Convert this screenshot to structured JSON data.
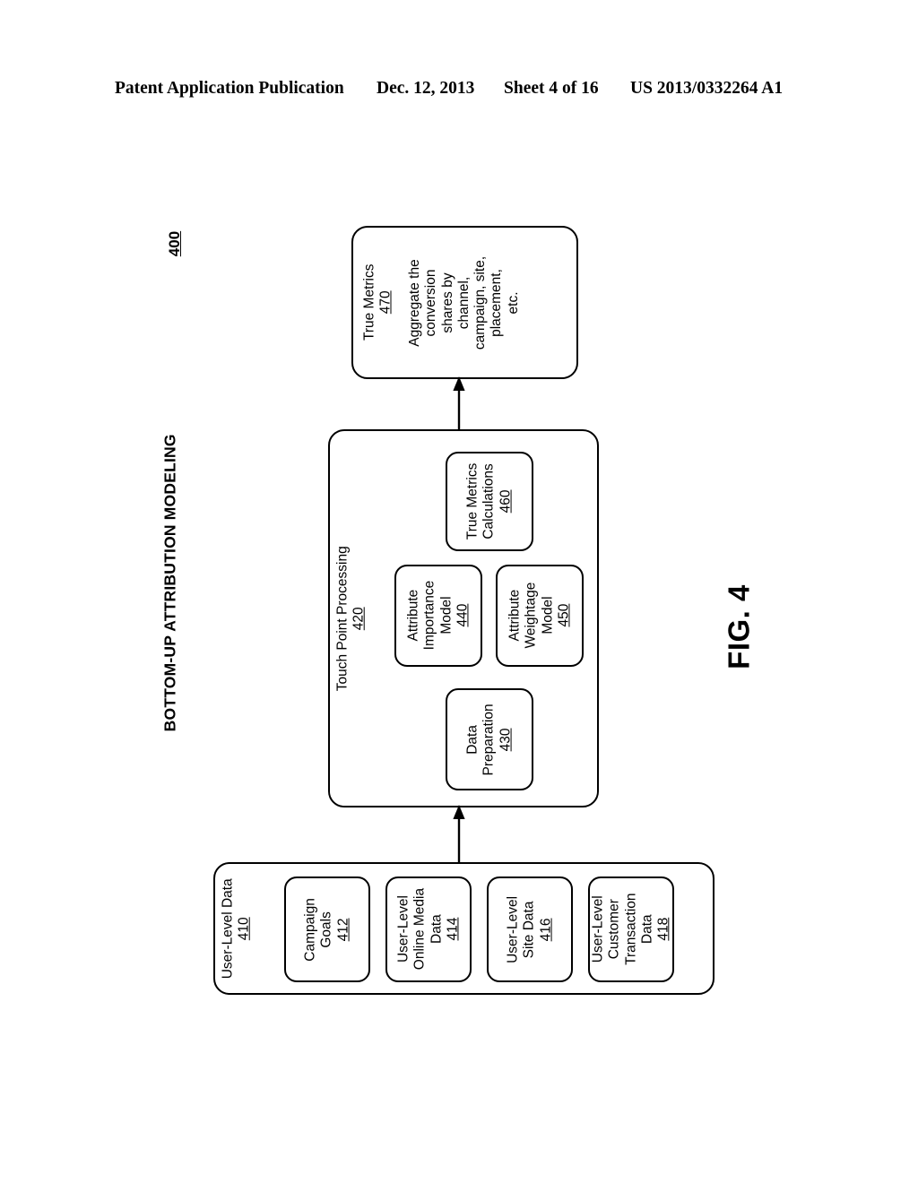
{
  "header": {
    "publication": "Patent Application Publication",
    "date": "Dec. 12, 2013",
    "sheet": "Sheet 4 of 16",
    "number": "US 2013/0332264 A1"
  },
  "figure": {
    "title": "BOTTOM-UP ATTRIBUTION MODELING",
    "diagram_ref": "400",
    "figure_number": "FIG. 4"
  },
  "diagram": {
    "type": "flowchart",
    "orientation": "rotated-90-ccw",
    "nodes": {
      "true_metrics": {
        "title": "True Metrics",
        "ref": "470",
        "body": "Aggregate the\nconversion\nshares by\nchannel,\ncampaign, site,\nplacement,\netc."
      },
      "touch_point_processing": {
        "title": "Touch Point Processing",
        "ref": "420"
      },
      "true_metrics_calculations": {
        "title": "True Metrics\nCalculations",
        "ref": "460"
      },
      "attribute_importance_model": {
        "title": "Attribute\nImportance\nModel",
        "ref": "440"
      },
      "attribute_weightage_model": {
        "title": "Attribute\nWeightage\nModel",
        "ref": "450"
      },
      "data_preparation": {
        "title": "Data\nPreparation",
        "ref": "430"
      },
      "user_level_data": {
        "title": "User-Level Data",
        "ref": "410"
      },
      "campaign_goals": {
        "title": "Campaign\nGoals",
        "ref": "412"
      },
      "online_media_data": {
        "title": "User-Level\nOnline Media\nData",
        "ref": "414"
      },
      "site_data": {
        "title": "User-Level\nSite Data",
        "ref": "416"
      },
      "customer_transaction_data": {
        "title": "User-Level\nCustomer\nTransaction\nData",
        "ref": "418"
      }
    },
    "edges": [
      {
        "from": "user_level_data",
        "to": "touch_point_processing",
        "style": "solid-arrow"
      },
      {
        "from": "touch_point_processing",
        "to": "true_metrics",
        "style": "solid-arrow"
      }
    ],
    "colors": {
      "stroke": "#000000",
      "fill": "#ffffff"
    }
  }
}
